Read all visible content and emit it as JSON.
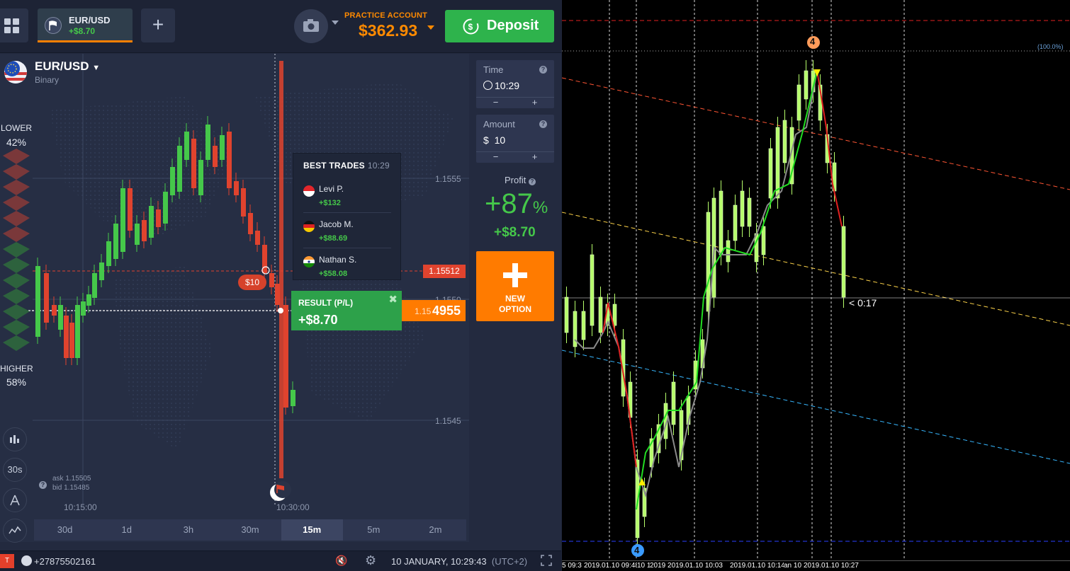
{
  "topbar": {
    "asset_tab": {
      "name": "EUR/USD",
      "profit": "+$8.70"
    },
    "account_label": "PRACTICE ACCOUNT",
    "balance": "$362.93",
    "deposit_label": "Deposit"
  },
  "asset": {
    "name": "EUR/USD",
    "type": "Binary"
  },
  "sentiment": {
    "lower_label": "LOWER",
    "lower_pct": "42%",
    "higher_label": "HIGHER",
    "higher_pct": "58%"
  },
  "tools": {
    "timer_label": "30s"
  },
  "price": {
    "ask": "ask 1.15505",
    "bid": "bid 1.15485",
    "level_1555": "1.1555",
    "level_1550": "1.1550",
    "level_1545": "1.1545",
    "strike": "1.15512",
    "current_prefix": "1.15",
    "current_suffix": "4955"
  },
  "trade_badge": "$10",
  "time_axis": [
    "10:15:00",
    "10:30:00"
  ],
  "timeframes": [
    {
      "label": "30d",
      "active": false
    },
    {
      "label": "1d",
      "active": false
    },
    {
      "label": "3h",
      "active": false
    },
    {
      "label": "30m",
      "active": false
    },
    {
      "label": "15m",
      "active": true
    },
    {
      "label": "5m",
      "active": false
    },
    {
      "label": "2m",
      "active": false
    }
  ],
  "best_trades": {
    "title": "BEST TRADES",
    "time": "10:29",
    "rows": [
      {
        "name": "Levi P.",
        "value": "+$132"
      },
      {
        "name": "Jacob M.",
        "value": "+$88.69"
      },
      {
        "name": "Nathan S.",
        "value": "+$58.08"
      }
    ]
  },
  "result": {
    "label": "RESULT (P/L)",
    "value": "+$8.70"
  },
  "controls": {
    "time_label": "Time",
    "time_value": "10:29",
    "amount_label": "Amount",
    "amount_currency": "$",
    "amount_value": "10",
    "minus": "−",
    "plus": "+",
    "profit_label": "Profit",
    "profit_pct": "+87",
    "profit_pct_sign": "%",
    "profit_value": "+$8.70",
    "new_option_label_1": "NEW",
    "new_option_label_2": "OPTION"
  },
  "bottombar": {
    "badge": "T",
    "phone": "+27875502161",
    "date": "10 JANUARY, 10:29:43",
    "tz": "(UTC+2)"
  },
  "mt4": {
    "marker_top": "4",
    "marker_bottom": "4",
    "fib_label": "(100.0%)",
    "countdown": "< 0:17",
    "time_labels": [
      "5 09:3",
      "2019.01.10 09:48",
      "10 1",
      "2019 2019.01.10 10:03",
      "2019.01.10 10:14",
      "an 10",
      "2019.01.10 10:27"
    ]
  },
  "colors": {
    "up": "#45c84a",
    "down": "#e0432e",
    "accent": "#ff7b00",
    "deposit": "#2eb34c"
  }
}
